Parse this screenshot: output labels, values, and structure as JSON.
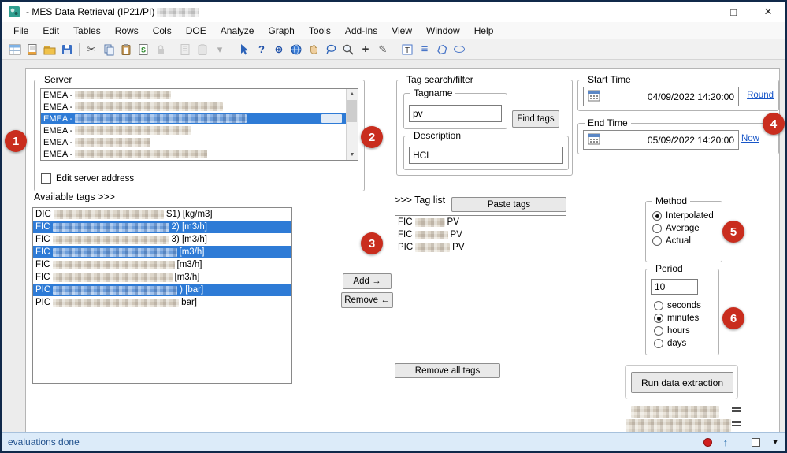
{
  "window": {
    "title": "- MES Data Retrieval (IP21/PI)",
    "controls": {
      "minimize": "—",
      "maximize": "□",
      "close": "×"
    }
  },
  "menubar": {
    "items": [
      "File",
      "Edit",
      "Tables",
      "Rows",
      "Cols",
      "DOE",
      "Analyze",
      "Graph",
      "Tools",
      "Add-Ins",
      "View",
      "Window",
      "Help"
    ]
  },
  "toolbar": {
    "icons": [
      {
        "name": "new-data-table"
      },
      {
        "name": "new-journal"
      },
      {
        "name": "open"
      },
      {
        "name": "save"
      },
      {
        "name": "cut",
        "glyph": "✂"
      },
      {
        "name": "copy"
      },
      {
        "name": "paste"
      },
      {
        "name": "paste-script"
      },
      {
        "name": "lock"
      },
      {
        "name": "journal-disabled"
      },
      {
        "name": "paste-disabled"
      },
      {
        "name": "dropdown-disabled",
        "glyph": "▾"
      },
      {
        "name": "select-arrow"
      },
      {
        "name": "help",
        "glyph": "?"
      },
      {
        "name": "crosshair",
        "glyph": "⊕"
      },
      {
        "name": "globe"
      },
      {
        "name": "grabber"
      },
      {
        "name": "lasso"
      },
      {
        "name": "magnifier"
      },
      {
        "name": "plus",
        "glyph": "+"
      },
      {
        "name": "pencil",
        "glyph": "✎"
      },
      {
        "name": "text-tool"
      },
      {
        "name": "line-tool",
        "glyph": "≡"
      },
      {
        "name": "polygon-tool"
      },
      {
        "name": "oval-tool"
      }
    ]
  },
  "badges": [
    "1",
    "2",
    "3",
    "4",
    "5",
    "6"
  ],
  "server": {
    "label": "Server",
    "rows": [
      {
        "prefix": "EMEA -"
      },
      {
        "prefix": "EMEA -"
      },
      {
        "prefix": "EMEA -"
      },
      {
        "prefix": "EMEA -"
      },
      {
        "prefix": "EMEA -"
      },
      {
        "prefix": "EMEA -"
      }
    ],
    "selected_index": 2,
    "edit_checkbox": "Edit server address"
  },
  "tag_search": {
    "label": "Tag search/filter",
    "tagname_label": "Tagname",
    "tagname_value": "pv",
    "find_button": "Find tags",
    "description_label": "Description",
    "description_value": "HCl"
  },
  "start_time": {
    "label": "Start Time",
    "value": "04/09/2022 14:20:00",
    "link": "Round"
  },
  "end_time": {
    "label": "End Time",
    "value": "05/09/2022 14:20:00",
    "link": "Now"
  },
  "available_tags": {
    "label": "Available tags >>>",
    "rows": [
      {
        "prefix": "DIC",
        "suffix": "S1) [kg/m3]",
        "selected": false
      },
      {
        "prefix": "FIC",
        "suffix": "2)  [m3/h]",
        "selected": true
      },
      {
        "prefix": "FIC",
        "suffix": "3)  [m3/h]",
        "selected": false
      },
      {
        "prefix": "FIC",
        "suffix": "[m3/h]",
        "selected": true
      },
      {
        "prefix": "FIC",
        "suffix": "[m3/h]",
        "selected": false
      },
      {
        "prefix": "FIC",
        "suffix": "[m3/h]",
        "selected": false
      },
      {
        "prefix": "PIC",
        "suffix": ")  [bar]",
        "selected": true
      },
      {
        "prefix": "PIC",
        "suffix": "bar]",
        "selected": false
      }
    ]
  },
  "transfer": {
    "add": "Add →",
    "remove": "Remove ←"
  },
  "tag_list": {
    "label": ">>> Tag list",
    "paste_button": "Paste tags",
    "remove_all_button": "Remove all tags",
    "rows": [
      {
        "prefix": "FIC",
        "suffix": "PV"
      },
      {
        "prefix": "FIC",
        "suffix": "PV"
      },
      {
        "prefix": "PIC",
        "suffix": "PV"
      }
    ]
  },
  "method": {
    "label": "Method",
    "options": [
      "Interpolated",
      "Average",
      "Actual"
    ],
    "selected": "Interpolated"
  },
  "period": {
    "label": "Period",
    "value": "10",
    "units": [
      "seconds",
      "minutes",
      "hours",
      "days"
    ],
    "selected": "minutes"
  },
  "run": {
    "label": "Run data extraction"
  },
  "status": {
    "text": "evaluations done",
    "up_glyph": "↑",
    "dropdown_glyph": "▼"
  },
  "colors": {
    "selection": "#2e7bd6",
    "badge": "#c92d1e",
    "link": "#1856c8",
    "status_text": "#23538f",
    "status_bg": "#dcebf9"
  }
}
